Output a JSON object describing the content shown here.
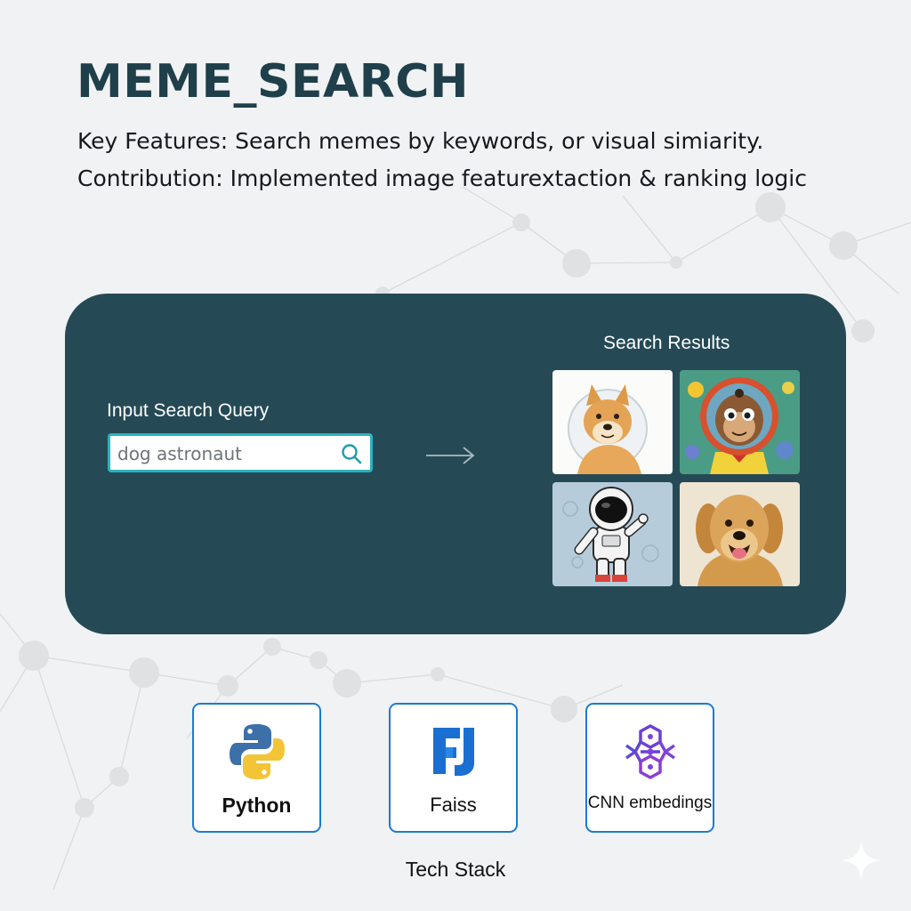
{
  "header": {
    "title": "MEME_SEARCH",
    "features_line": "Key Features: Search memes by keywords, or visual simiarity.",
    "contribution_line": "Contribution: Implemented image featurextaction & ranking logic"
  },
  "search_panel": {
    "query_label": "Input Search Query",
    "search": {
      "value": "dog astronaut",
      "icon": "search-icon"
    },
    "arrow_icon": "arrow-right-icon",
    "results_label": "Search Results",
    "results": [
      {
        "name": "doge-in-space-helmet"
      },
      {
        "name": "cartoon-monkey-astronaut"
      },
      {
        "name": "cartoon-astronaut"
      },
      {
        "name": "golden-retriever"
      }
    ]
  },
  "tech_stack": {
    "label": "Tech Stack",
    "items": [
      {
        "label": "Python",
        "icon": "python-logo-icon"
      },
      {
        "label": "Faiss",
        "icon": "faiss-logo-icon"
      },
      {
        "label": "CNN embedings",
        "icon": "network-nodes-icon"
      }
    ]
  },
  "colors": {
    "background": "#f1f2f3",
    "panel": "#254a56",
    "title": "#1f3f4a",
    "search_border": "#2ab3bf",
    "card_border": "#1b7bd3"
  }
}
